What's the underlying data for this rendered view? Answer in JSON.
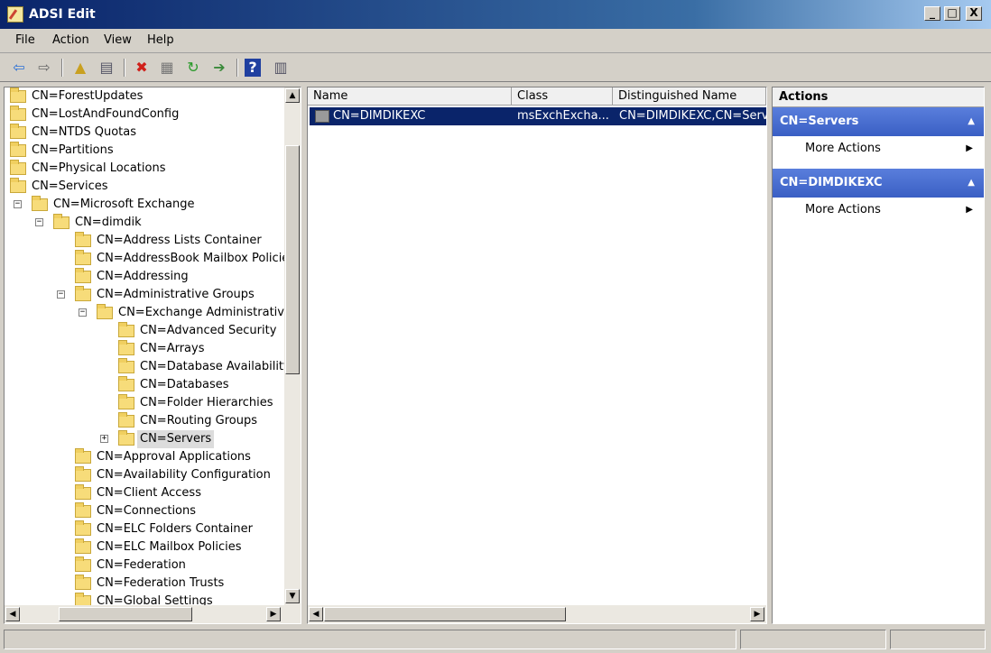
{
  "window": {
    "title": "ADSI Edit",
    "controls": [
      "_",
      "□",
      "X"
    ]
  },
  "menu": {
    "items": [
      "File",
      "Action",
      "View",
      "Help"
    ]
  },
  "toolbar": {
    "buttons": [
      {
        "icon": "back-arrow-icon"
      },
      {
        "icon": "forward-arrow-icon"
      },
      {
        "icon": "up-folder-icon"
      },
      {
        "icon": "show-hide-console-tree-icon"
      },
      {
        "icon": "delete-icon"
      },
      {
        "icon": "properties-icon"
      },
      {
        "icon": "refresh-icon"
      },
      {
        "icon": "export-list-icon"
      },
      {
        "icon": "help-icon"
      },
      {
        "icon": "show-hide-action-pane-icon"
      }
    ]
  },
  "tree": {
    "nodes": [
      {
        "label": "CN=ForestUpdates",
        "depth": 0,
        "expander": ""
      },
      {
        "label": "CN=LostAndFoundConfig",
        "depth": 0,
        "expander": ""
      },
      {
        "label": "CN=NTDS Quotas",
        "depth": 0,
        "expander": ""
      },
      {
        "label": "CN=Partitions",
        "depth": 0,
        "expander": ""
      },
      {
        "label": "CN=Physical Locations",
        "depth": 0,
        "expander": ""
      },
      {
        "label": "CN=Services",
        "depth": 0,
        "expander": ""
      },
      {
        "label": "CN=Microsoft Exchange",
        "depth": 1,
        "expander": "−"
      },
      {
        "label": "CN=dimdik",
        "depth": 2,
        "expander": "−"
      },
      {
        "label": "CN=Address Lists Container",
        "depth": 3,
        "expander": ""
      },
      {
        "label": "CN=AddressBook Mailbox Policies",
        "depth": 3,
        "expander": ""
      },
      {
        "label": "CN=Addressing",
        "depth": 3,
        "expander": ""
      },
      {
        "label": "CN=Administrative Groups",
        "depth": 3,
        "expander": "−"
      },
      {
        "label": "CN=Exchange Administrative G",
        "depth": 4,
        "expander": "−"
      },
      {
        "label": "CN=Advanced Security",
        "depth": 5,
        "expander": ""
      },
      {
        "label": "CN=Arrays",
        "depth": 5,
        "expander": ""
      },
      {
        "label": "CN=Database Availability G",
        "depth": 5,
        "expander": ""
      },
      {
        "label": "CN=Databases",
        "depth": 5,
        "expander": ""
      },
      {
        "label": "CN=Folder Hierarchies",
        "depth": 5,
        "expander": ""
      },
      {
        "label": "CN=Routing Groups",
        "depth": 5,
        "expander": ""
      },
      {
        "label": "CN=Servers",
        "depth": 5,
        "expander": "+",
        "selected": true
      },
      {
        "label": "CN=Approval Applications",
        "depth": 3,
        "expander": ""
      },
      {
        "label": "CN=Availability Configuration",
        "depth": 3,
        "expander": ""
      },
      {
        "label": "CN=Client Access",
        "depth": 3,
        "expander": ""
      },
      {
        "label": "CN=Connections",
        "depth": 3,
        "expander": ""
      },
      {
        "label": "CN=ELC Folders Container",
        "depth": 3,
        "expander": ""
      },
      {
        "label": "CN=ELC Mailbox Policies",
        "depth": 3,
        "expander": ""
      },
      {
        "label": "CN=Federation",
        "depth": 3,
        "expander": ""
      },
      {
        "label": "CN=Federation Trusts",
        "depth": 3,
        "expander": ""
      },
      {
        "label": "CN=Global Settings",
        "depth": 3,
        "expander": ""
      }
    ]
  },
  "list": {
    "columns": [
      "Name",
      "Class",
      "Distinguished Name"
    ],
    "rows": [
      {
        "name": "CN=DIMDIKEXC",
        "class": "msExchExcha...",
        "dn": "CN=DIMDIKEXC,CN=Serve"
      }
    ]
  },
  "actions": {
    "header": "Actions",
    "groups": [
      {
        "title": "CN=Servers",
        "items": [
          "More Actions"
        ]
      },
      {
        "title": "CN=DIMDIKEXC",
        "items": [
          "More Actions"
        ]
      }
    ]
  }
}
